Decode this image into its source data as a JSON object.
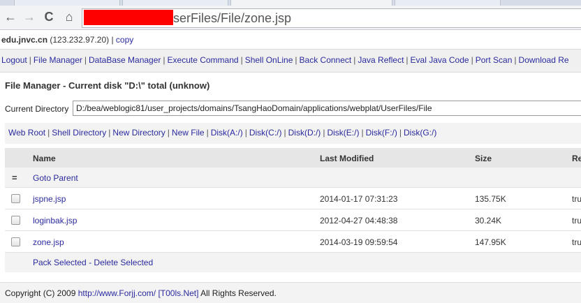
{
  "browser": {
    "back_glyph": "←",
    "forward_glyph": "→",
    "reload_glyph": "C",
    "home_glyph": "⌂",
    "url": "serFiles/File/zone.jsp"
  },
  "host": {
    "name": "edu.jnvc.cn",
    "ip": "(123.232.97.20)",
    "separator": "|",
    "copy_label": "copy"
  },
  "menu": {
    "items": [
      "Logout",
      "File Manager",
      "DataBase Manager",
      "Execute Command",
      "Shell OnLine",
      "Back Connect",
      "Java Reflect",
      "Eval Java Code",
      "Port Scan",
      "Download Re"
    ],
    "separator": "|"
  },
  "page_title": "File Manager - Current disk \"D:\\\" total (unknow)",
  "current_directory": {
    "label": "Current Directory",
    "value": "D:/bea/weblogic81/user_projects/domains/TsangHaoDomain/applications/webplat/UserFiles/File"
  },
  "quick_links": {
    "items": [
      "Web Root",
      "Shell Directory",
      "New Directory",
      "New File",
      "Disk(A:/)",
      "Disk(C:/)",
      "Disk(D:/)",
      "Disk(E:/)",
      "Disk(F:/)",
      "Disk(G:/)"
    ],
    "separator": "|"
  },
  "table": {
    "headers": {
      "name": "Name",
      "last_modified": "Last Modified",
      "size": "Size",
      "r": "Re"
    },
    "parent_icon": "=",
    "goto_parent": "Goto Parent",
    "rows": [
      {
        "name": "jspne.jsp",
        "last_modified": "2014-01-17 07:31:23",
        "size": "135.75K",
        "r": "tru"
      },
      {
        "name": "loginbak.jsp",
        "last_modified": "2012-04-27 04:48:38",
        "size": "30.24K",
        "r": "tru"
      },
      {
        "name": "zone.jsp",
        "last_modified": "2014-03-19 09:59:54",
        "size": "147.95K",
        "r": "tru"
      }
    ],
    "pack_selected": "Pack Selected",
    "action_separator": "-",
    "delete_selected": "Delete Selected"
  },
  "footer": {
    "copyright": "Copyright (C) 2009",
    "link1": "http://www.Forjj.com/",
    "link2": "[T00ls.Net]",
    "rights": "All Rights Reserved."
  }
}
